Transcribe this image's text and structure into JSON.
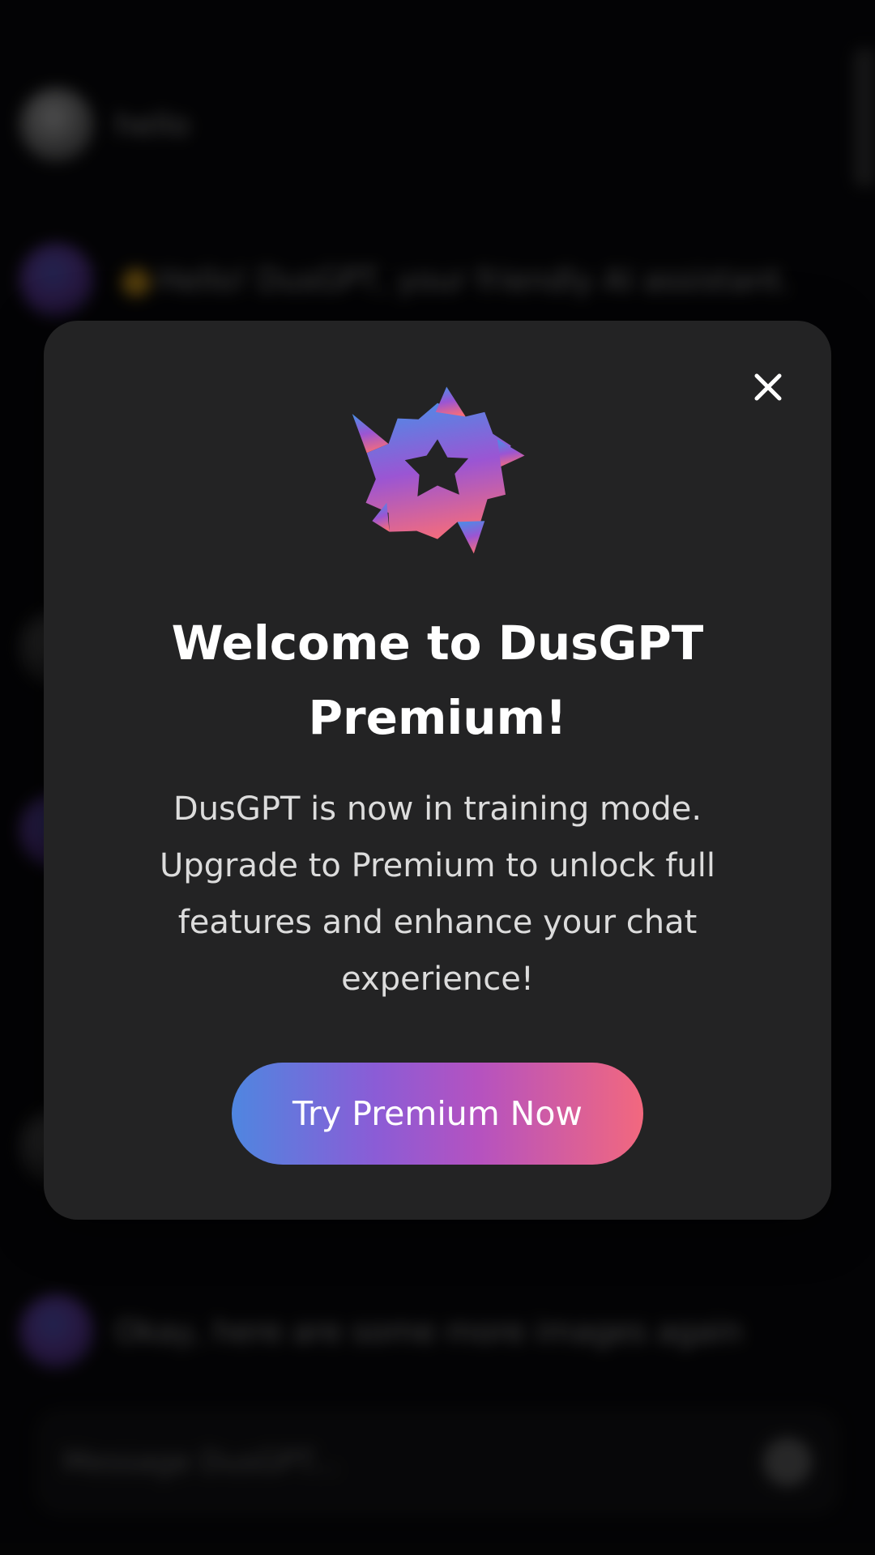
{
  "background": {
    "messages": [
      {
        "role": "user",
        "text": "hello"
      },
      {
        "role": "bot",
        "text": "Hello! DusGPT, your friendly AI assistant."
      },
      {
        "role": "user",
        "text": ""
      },
      {
        "role": "bot",
        "text": ""
      },
      {
        "role": "user",
        "text": ""
      },
      {
        "role": "bot",
        "text": "Okay, here are some more images again"
      }
    ],
    "input_placeholder": "Message DusGPT..."
  },
  "modal": {
    "close_icon": "close-icon",
    "logo_icon": "dusgpt-logo-icon",
    "title": "Welcome to DusGPT Premium!",
    "description": "DusGPT is now in training mode. Upgrade to Premium to unlock full features and enhance your chat experience!",
    "cta_label": "Try Premium Now"
  },
  "colors": {
    "modal_bg": "#232324",
    "gradient_start": "#4f86e0",
    "gradient_mid": "#b552c0",
    "gradient_end": "#f2687e"
  }
}
